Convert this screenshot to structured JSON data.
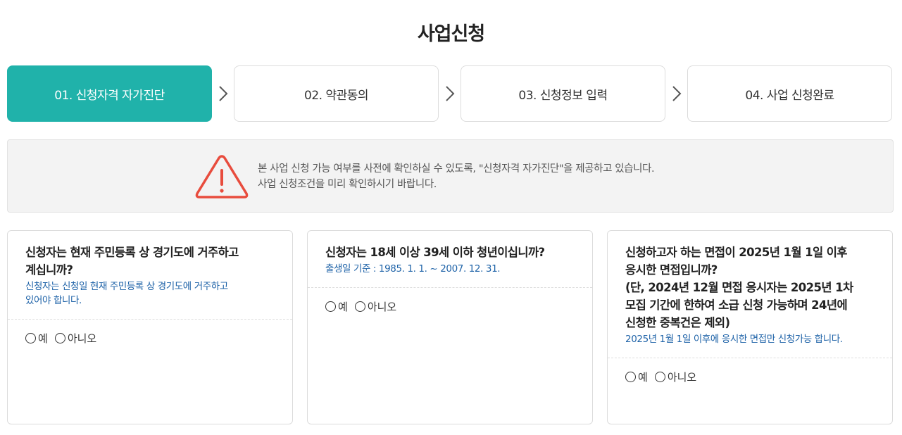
{
  "page": {
    "title": "사업신청"
  },
  "steps": [
    {
      "label": "01. 신청자격 자가진단",
      "active": true
    },
    {
      "label": "02. 약관동의",
      "active": false
    },
    {
      "label": "03. 신청정보 입력",
      "active": false
    },
    {
      "label": "04. 사업 신청완료",
      "active": false
    }
  ],
  "notice": {
    "line1": "본 사업 신청 가능 여부를 사전에 확인하실 수 있도록, \"신청자격 자가진단\"을 제공하고 있습니다.",
    "line2": "사업 신청조건을 미리 확인하시기 바랍니다.",
    "icon": "warning-triangle-icon",
    "icon_color": "#e84c3d"
  },
  "questions": [
    {
      "title_lines": [
        "신청자는 현재 주민등록 상 경기도에 거주하고",
        "계십니까?"
      ],
      "sub_lines": [
        "신청자는 신청일 현재 주민등록 상 경기도에 거주하고",
        "있어야 합니다."
      ],
      "options": [
        "예",
        "아니오"
      ]
    },
    {
      "title_lines": [
        "신청자는 18세 이상 39세 이하 청년이십니까?"
      ],
      "sub_lines": [
        "출생일 기준 : 1985. 1. 1. ~ 2007. 12. 31."
      ],
      "options": [
        "예",
        "아니오"
      ]
    },
    {
      "title_lines": [
        "신청하고자 하는 면접이 2025년 1월 1일 이후",
        "응시한 면접입니까?",
        "(단, 2024년 12월 면접 응시자는 2025년 1차",
        "모집 기간에 한하여 소급 신청 가능하며 24년에",
        "신청한 중복건은 제외)"
      ],
      "sub_lines": [
        "2025년 1월 1일 이후에 응시한 면접만 신청가능 합니다."
      ],
      "options": [
        "예",
        "아니오"
      ]
    }
  ],
  "colors": {
    "accent": "#20b2aa",
    "sub_text": "#1f63a8",
    "warning": "#e84c3d"
  }
}
